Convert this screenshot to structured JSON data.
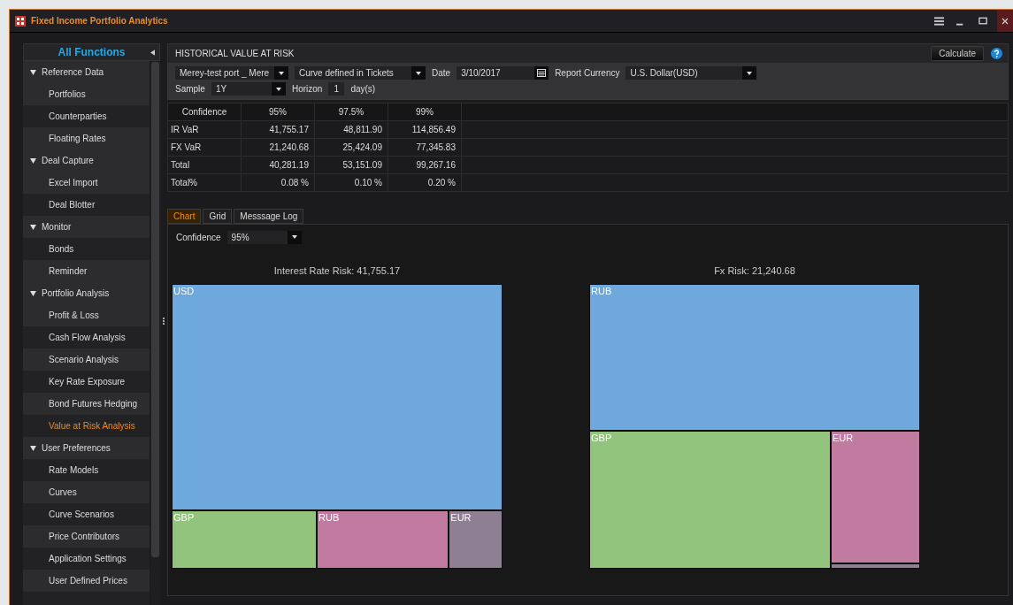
{
  "window": {
    "title": "Fixed Income Portfolio Analytics"
  },
  "sidebar": {
    "title": "All Functions",
    "groups": [
      {
        "label": "Reference Data",
        "expanded": true,
        "items": [
          {
            "label": "Portfolios",
            "selected": false
          },
          {
            "label": "Counterparties",
            "selected": false
          },
          {
            "label": "Floating Rates",
            "selected": false
          }
        ]
      },
      {
        "label": "Deal Capture",
        "expanded": true,
        "items": [
          {
            "label": "Excel Import",
            "selected": false
          },
          {
            "label": "Deal Blotter",
            "selected": false
          }
        ]
      },
      {
        "label": "Monitor",
        "expanded": true,
        "items": [
          {
            "label": "Bonds",
            "selected": false
          },
          {
            "label": "Reminder",
            "selected": false
          }
        ]
      },
      {
        "label": "Portfolio Analysis",
        "expanded": true,
        "items": [
          {
            "label": "Profit & Loss",
            "selected": false
          },
          {
            "label": "Cash Flow Analysis",
            "selected": false
          },
          {
            "label": "Scenario Analysis",
            "selected": false
          },
          {
            "label": "Key Rate Exposure",
            "selected": false
          },
          {
            "label": "Bond Futures Hedging",
            "selected": false
          },
          {
            "label": "Value at Risk Analysis",
            "selected": true
          }
        ]
      },
      {
        "label": "User Preferences",
        "expanded": true,
        "items": [
          {
            "label": "Rate Models",
            "selected": false
          },
          {
            "label": "Curves",
            "selected": false
          },
          {
            "label": "Curve Scenarios",
            "selected": false
          },
          {
            "label": "Price Contributors",
            "selected": false
          },
          {
            "label": "Application Settings",
            "selected": false
          },
          {
            "label": "User Defined Prices",
            "selected": false
          }
        ]
      }
    ]
  },
  "panel": {
    "title": "HISTORICAL VALUE AT RISK",
    "calculate": "Calculate",
    "portfolio": "Merey-test port _ Mere",
    "curve": "Curve defined in Tickets",
    "date_label": "Date",
    "date": "3/10/2017",
    "currency_label": "Report Currency",
    "currency": "U.S. Dollar(USD)",
    "sample_label": "Sample",
    "sample": "1Y",
    "horizon_label": "Horizon",
    "horizon": "1",
    "horizon_unit": "day(s)"
  },
  "table": {
    "columns": [
      "Confidence",
      "95%",
      "97.5%",
      "99%"
    ],
    "rows": [
      [
        "IR VaR",
        "41,755.17",
        "48,811.90",
        "114,856.49"
      ],
      [
        "FX VaR",
        "21,240.68",
        "25,424.09",
        "77,345.83"
      ],
      [
        "Total",
        "40,281.19",
        "53,151.09",
        "99,267.16"
      ],
      [
        "Total%",
        "0.08 %",
        "0.10 %",
        "0.20 %"
      ]
    ]
  },
  "tabs": [
    {
      "label": "Chart",
      "selected": true
    },
    {
      "label": "Grid",
      "selected": false
    },
    {
      "label": "Messsage Log",
      "selected": false
    }
  ],
  "chart_confidence": {
    "label": "Confidence",
    "value": "95%"
  },
  "treemaps": [
    {
      "title": "Interest Rate Risk: 41,755.17",
      "tiles": [
        {
          "label": "USD",
          "color": "#6fa8dc"
        },
        {
          "label": "GBP",
          "color": "#93c47d"
        },
        {
          "label": "RUB",
          "color": "#c27ba0"
        },
        {
          "label": "EUR",
          "color": "#8e7f92"
        }
      ]
    },
    {
      "title": "Fx Risk: 21,240.68",
      "tiles": [
        {
          "label": "RUB",
          "color": "#6fa8dc"
        },
        {
          "label": "GBP",
          "color": "#93c47d"
        },
        {
          "label": "EUR",
          "color": "#c27ba0"
        },
        {
          "color": "#8e7f92"
        }
      ]
    }
  ]
}
